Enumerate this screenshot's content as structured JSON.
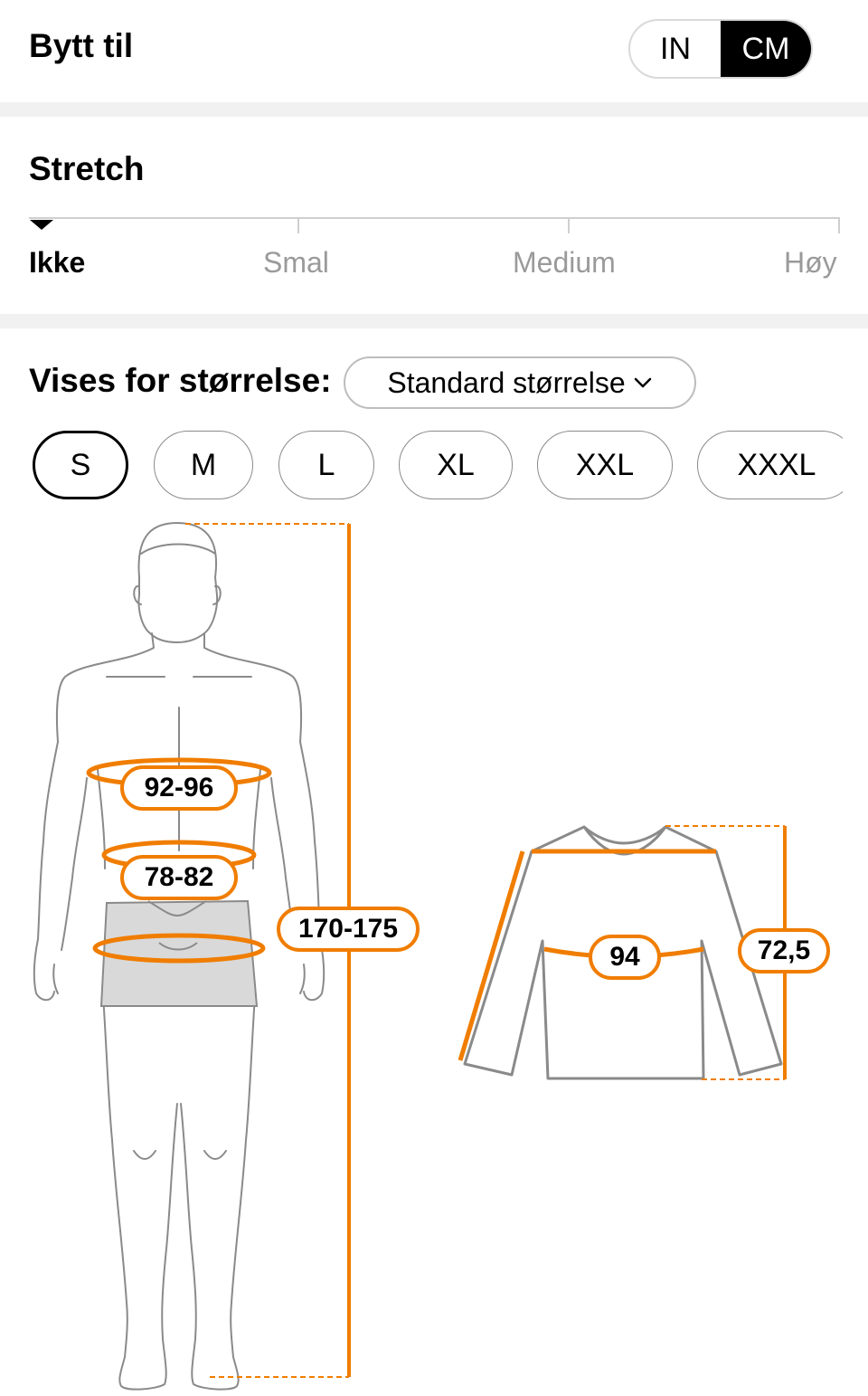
{
  "unit_switch": {
    "title": "Bytt til",
    "options": [
      "IN",
      "CM"
    ],
    "selected": "CM"
  },
  "stretch": {
    "title": "Stretch",
    "levels": [
      "Ikke",
      "Smal",
      "Medium",
      "Høy"
    ],
    "selected": "Ikke"
  },
  "size_selector": {
    "label": "Vises for størrelse:",
    "dropdown_value": "Standard størrelse",
    "sizes": [
      "S",
      "M",
      "L",
      "XL",
      "XXL",
      "XXXL"
    ],
    "selected_size": "S"
  },
  "body_measurements": {
    "chest": "92-96",
    "waist": "78-82",
    "height": "170-175"
  },
  "garment_measurements": {
    "chest": "94",
    "length": "72,5"
  },
  "colors": {
    "accent": "#f07d00",
    "outline": "#8a8a8a"
  }
}
